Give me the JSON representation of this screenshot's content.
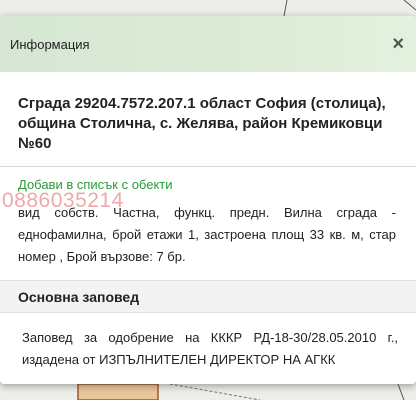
{
  "popup": {
    "title": "Информация",
    "close_glyph": "×",
    "close_icon": "close-icon"
  },
  "object": {
    "title": "Сграда 29204.7572.207.1 област София (столица), община Столична, с. Желява, район Кремиковци №60",
    "add_link": "Добави в списък с обекти",
    "watermark_phone": "0886035214",
    "description": "вид собств. Частна, функц. предн. Вилна сграда - еднофамилна, брой етажи 1, застроена площ 33 кв. м, стар номер , Брой вързове: 7 бр."
  },
  "order_section": {
    "header": "Основна заповед",
    "text": "Заповед за одобрение на КККР РД-18-30/28.05.2010 г., издадена от ИЗПЪЛНИТЕЛЕН ДИРЕКТОР НА АГКК"
  },
  "colors": {
    "link": "#2a9a3d",
    "header_gradient": "#d5e7d4",
    "watermark": "#dc3c3c"
  }
}
